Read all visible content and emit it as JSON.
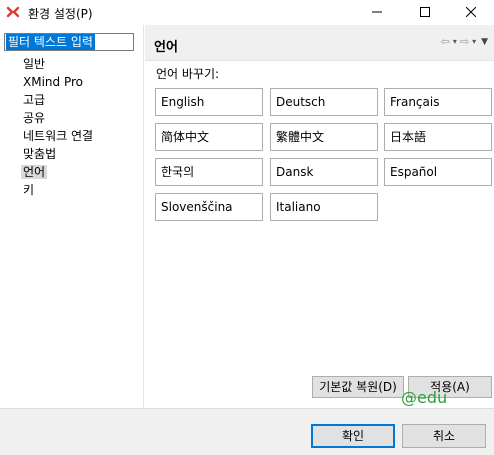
{
  "window": {
    "title": "환경 설정(P)",
    "icon": "xmind-logo-icon",
    "controls": [
      "minimize-icon",
      "maximize-icon",
      "close-icon"
    ]
  },
  "sidebar": {
    "filter_value": "필터 텍스트 입력",
    "items": [
      {
        "label": "일반"
      },
      {
        "label": "XMind Pro"
      },
      {
        "label": "고급"
      },
      {
        "label": "공유"
      },
      {
        "label": "네트워크 연결"
      },
      {
        "label": "맞춤법"
      },
      {
        "label": "언어",
        "selected": true
      },
      {
        "label": "키"
      }
    ]
  },
  "page": {
    "title": "언어",
    "nav": {
      "back": "⇦",
      "forward": "⇨",
      "dropdown": "▾",
      "menu": "▼"
    },
    "language_label": "언어 바꾸기:",
    "languages": [
      "English",
      "Deutsch",
      "Français",
      "简体中文",
      "繁體中文",
      "日本語",
      "한국의",
      "Dansk",
      "Español",
      "Slovenščina",
      "Italiano"
    ],
    "restore_defaults": "기본값 복원(D)",
    "apply": "적용(A)"
  },
  "footer": {
    "ok": "확인",
    "cancel": "취소"
  },
  "watermark": "@edu",
  "colors": {
    "selection_blue": "#0078d7",
    "watermark_green": "#2e9e3e",
    "header_bg": "#f0f0f0",
    "logo_red": "#e4382f"
  }
}
